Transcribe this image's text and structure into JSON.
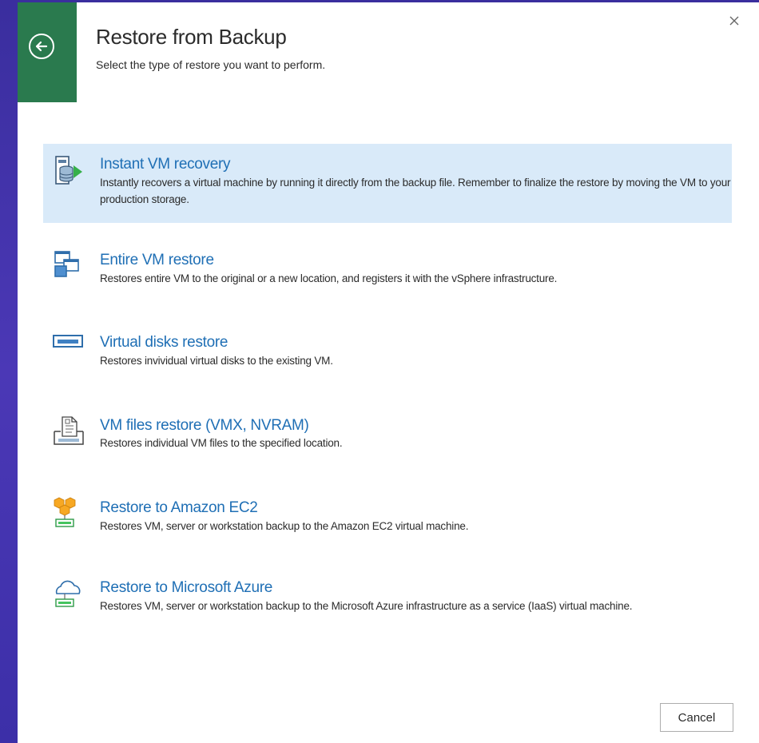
{
  "dialog": {
    "title": "Restore from Backup",
    "subtitle": "Select the type of restore you want to perform.",
    "close_icon": "close-icon",
    "back_icon": "back-arrow-icon",
    "accent_color": "#2a7a4e",
    "selected_color": "#d9eaf9",
    "link_color": "#1f6fb5"
  },
  "options": [
    {
      "title": "Instant VM recovery",
      "description": "Instantly recovers a virtual machine by running it directly from the backup file. Remember to finalize the restore by moving the VM to your production storage.",
      "icon": "instant-vm-recovery-icon",
      "selected": true
    },
    {
      "title": "Entire VM restore",
      "description": "Restores entire VM to the original or a new location, and registers it with the vSphere infrastructure.",
      "icon": "entire-vm-restore-icon",
      "selected": false
    },
    {
      "title": "Virtual disks restore",
      "description": "Restores invividual virtual disks to the existing VM.",
      "icon": "virtual-disk-icon",
      "selected": false
    },
    {
      "title": "VM files restore (VMX, NVRAM)",
      "description": "Restores individual VM files to the specified location.",
      "icon": "vm-files-icon",
      "selected": false
    },
    {
      "title": "Restore to Amazon EC2",
      "description": "Restores VM, server or workstation backup to the Amazon EC2 virtual machine.",
      "icon": "amazon-ec2-icon",
      "selected": false
    },
    {
      "title": "Restore to Microsoft Azure",
      "description": "Restores VM, server or workstation backup to the Microsoft Azure infrastructure as a service (IaaS) virtual machine.",
      "icon": "microsoft-azure-icon",
      "selected": false
    }
  ],
  "footer": {
    "cancel_label": "Cancel"
  }
}
